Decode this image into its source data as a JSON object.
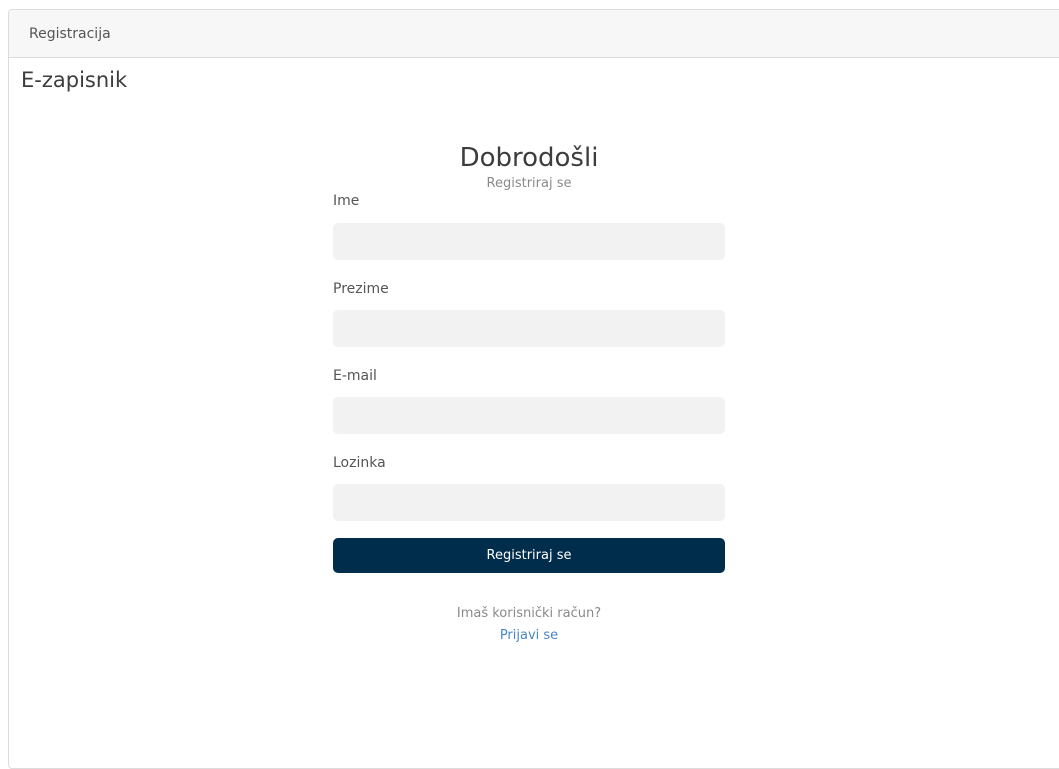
{
  "header": {
    "title": "Registracija"
  },
  "app": {
    "title": "E-zapisnik"
  },
  "form": {
    "heading": "Dobrodošli",
    "subheading": "Registriraj se",
    "fields": [
      {
        "label": "Ime",
        "value": "",
        "placeholder": ""
      },
      {
        "label": "Prezime",
        "value": "",
        "placeholder": ""
      },
      {
        "label": "E-mail",
        "value": "",
        "placeholder": ""
      },
      {
        "label": "Lozinka",
        "value": "",
        "placeholder": ""
      }
    ],
    "submit_label": "Registriraj se",
    "account_question": "Imaš korisnički račun?",
    "login_link": "Prijavi se"
  },
  "colors": {
    "primary_button": "#002d4b",
    "link": "#4a86c5",
    "input_background": "#f2f2f2",
    "header_background": "#f7f7f7"
  }
}
